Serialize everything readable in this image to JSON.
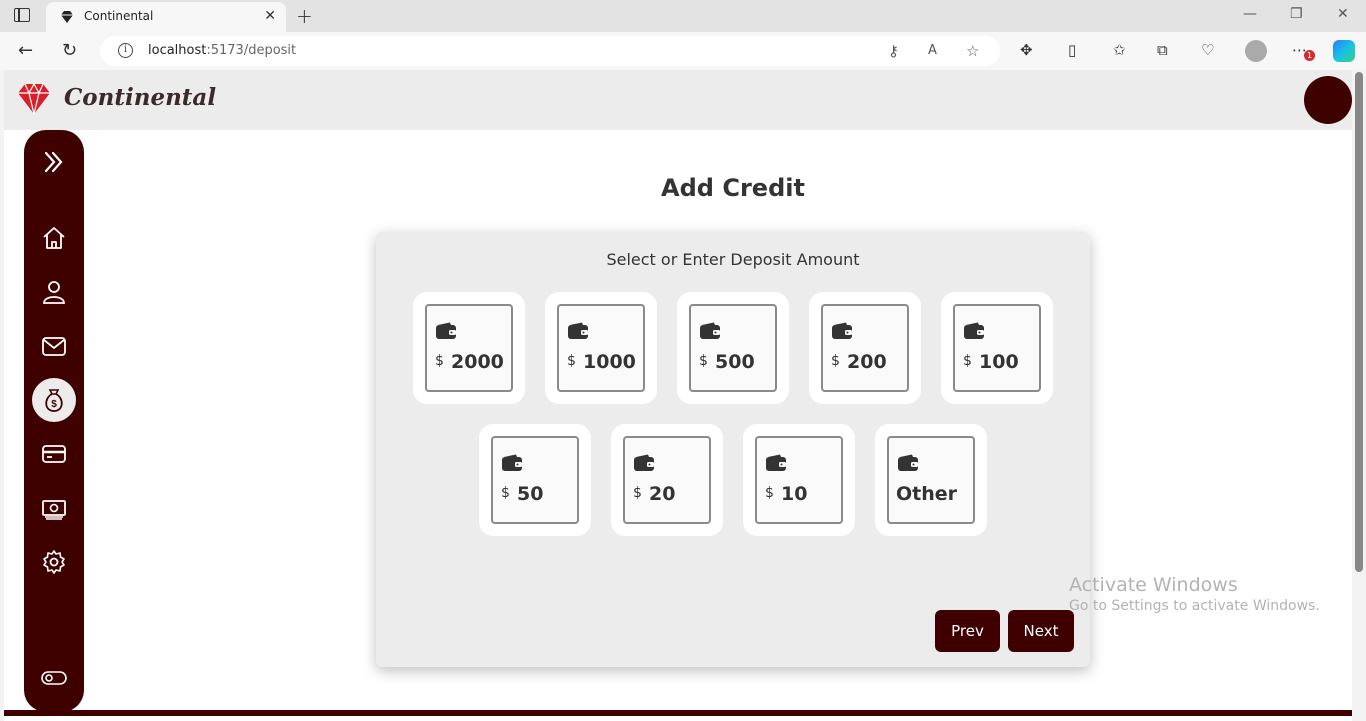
{
  "browser": {
    "tab_title": "Continental",
    "url_host": "localhost",
    "url_path": ":5173/deposit",
    "new_tab_glyph": "+",
    "close_glyph": "✕",
    "minimize_glyph": "—",
    "restore_glyph": "❐",
    "window_close_glyph": "✕",
    "notification_badge": "1"
  },
  "header": {
    "brand": "Continental"
  },
  "sidebar": {
    "items": [
      {
        "name": "expand-icon"
      },
      {
        "name": "home-icon"
      },
      {
        "name": "user-icon"
      },
      {
        "name": "mail-icon"
      },
      {
        "name": "money-bag-icon",
        "active": true
      },
      {
        "name": "card-icon"
      },
      {
        "name": "cash-icon"
      },
      {
        "name": "gear-icon"
      },
      {
        "name": "toggle-icon"
      }
    ]
  },
  "main": {
    "title": "Add Credit",
    "subtitle": "Select or Enter Deposit Amount",
    "currency": "$",
    "amounts": [
      "2000",
      "1000",
      "500",
      "200",
      "100",
      "50",
      "20",
      "10"
    ],
    "other_label": "Other",
    "prev_label": "Prev",
    "next_label": "Next"
  },
  "watermark": {
    "line1": "Activate Windows",
    "line2": "Go to Settings to activate Windows."
  },
  "colors": {
    "brand_dark": "#3f0000",
    "gem_red": "#d9202a"
  }
}
